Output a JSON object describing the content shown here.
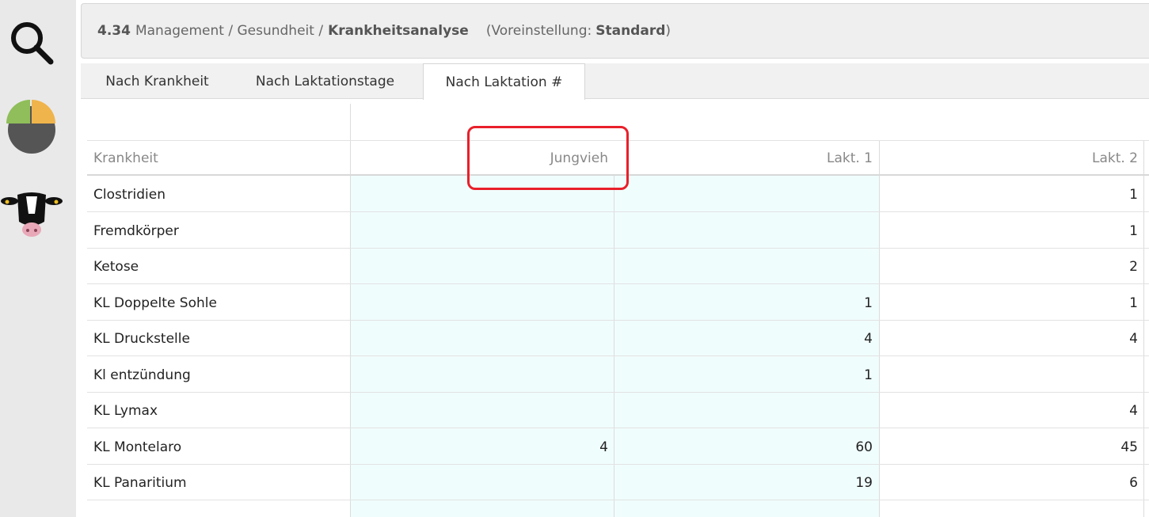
{
  "sidebar": {
    "icons": [
      "search-icon",
      "pie-chart-icon",
      "cow-icon"
    ]
  },
  "breadcrumb": {
    "code": "4.34",
    "path": "Management / Gesundheit /",
    "current": "Krankheitsanalyse",
    "preset_prefix": "(Voreinstellung:",
    "preset_value": "Standard",
    "preset_suffix": ")"
  },
  "tabs": [
    {
      "label": "Nach Krankheit",
      "active": false
    },
    {
      "label": "Nach Laktationstage",
      "active": false
    },
    {
      "label": "Nach Laktation #",
      "active": true
    }
  ],
  "table": {
    "headers": [
      "Krankheit",
      "Jungvieh",
      "Lakt. 1",
      "Lakt. 2"
    ],
    "rows": [
      {
        "name": "Clostridien",
        "jungvieh": "",
        "lakt1": "",
        "lakt2": "1"
      },
      {
        "name": "Fremdkörper",
        "jungvieh": "",
        "lakt1": "",
        "lakt2": "1"
      },
      {
        "name": "Ketose",
        "jungvieh": "",
        "lakt1": "",
        "lakt2": "2"
      },
      {
        "name": "KL Doppelte Sohle",
        "jungvieh": "",
        "lakt1": "1",
        "lakt2": "1"
      },
      {
        "name": "KL Druckstelle",
        "jungvieh": "",
        "lakt1": "4",
        "lakt2": "4"
      },
      {
        "name": "Kl entzündung",
        "jungvieh": "",
        "lakt1": "1",
        "lakt2": ""
      },
      {
        "name": "KL Lymax",
        "jungvieh": "",
        "lakt1": "",
        "lakt2": "4"
      },
      {
        "name": "KL Montelaro",
        "jungvieh": "4",
        "lakt1": "60",
        "lakt2": "45"
      },
      {
        "name": "KL Panaritium",
        "jungvieh": "",
        "lakt1": "19",
        "lakt2": "6"
      }
    ]
  },
  "colors": {
    "highlight": "#e8202a",
    "cyan_fill": "#f0fdfd"
  }
}
